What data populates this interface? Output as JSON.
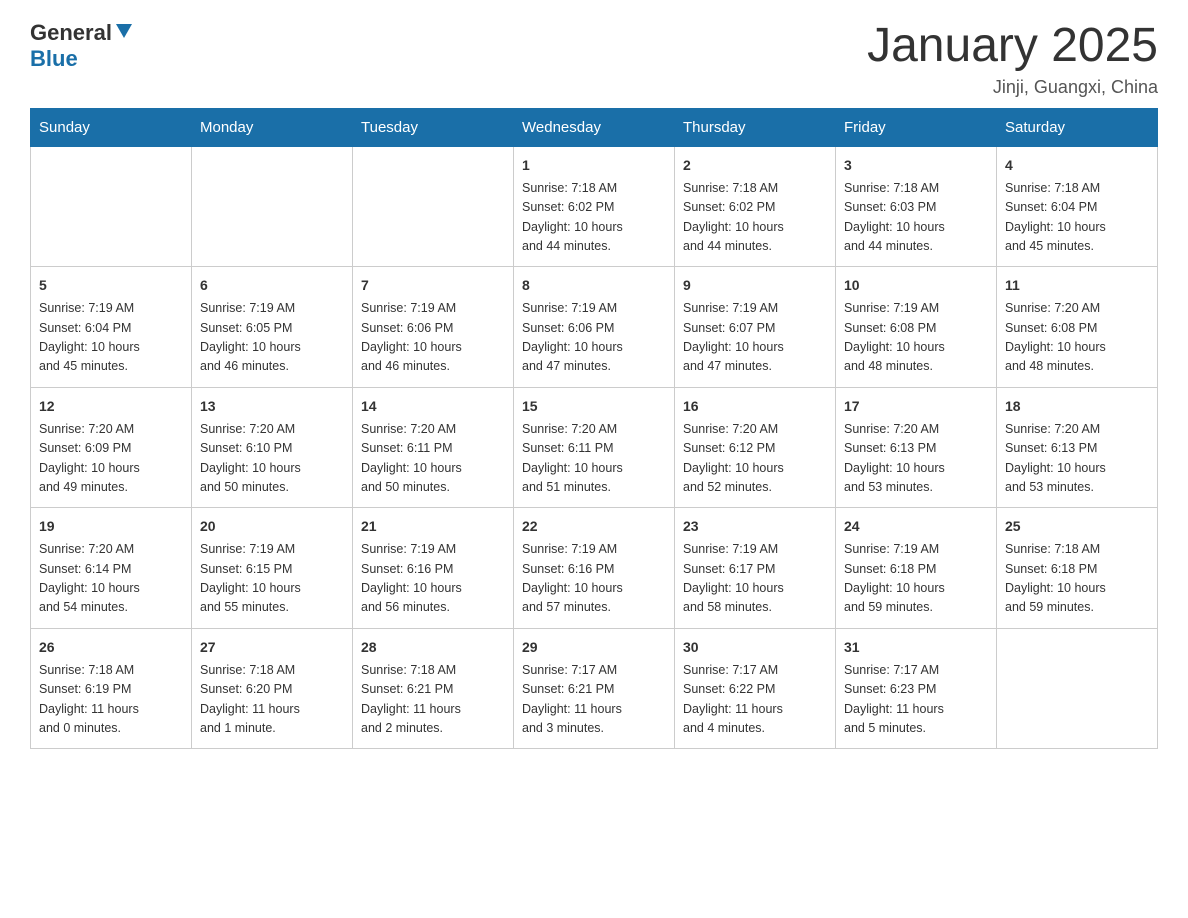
{
  "logo": {
    "general": "General",
    "blue": "Blue"
  },
  "title": "January 2025",
  "subtitle": "Jinji, Guangxi, China",
  "weekdays": [
    "Sunday",
    "Monday",
    "Tuesday",
    "Wednesday",
    "Thursday",
    "Friday",
    "Saturday"
  ],
  "weeks": [
    [
      {
        "day": "",
        "info": ""
      },
      {
        "day": "",
        "info": ""
      },
      {
        "day": "",
        "info": ""
      },
      {
        "day": "1",
        "info": "Sunrise: 7:18 AM\nSunset: 6:02 PM\nDaylight: 10 hours\nand 44 minutes."
      },
      {
        "day": "2",
        "info": "Sunrise: 7:18 AM\nSunset: 6:02 PM\nDaylight: 10 hours\nand 44 minutes."
      },
      {
        "day": "3",
        "info": "Sunrise: 7:18 AM\nSunset: 6:03 PM\nDaylight: 10 hours\nand 44 minutes."
      },
      {
        "day": "4",
        "info": "Sunrise: 7:18 AM\nSunset: 6:04 PM\nDaylight: 10 hours\nand 45 minutes."
      }
    ],
    [
      {
        "day": "5",
        "info": "Sunrise: 7:19 AM\nSunset: 6:04 PM\nDaylight: 10 hours\nand 45 minutes."
      },
      {
        "day": "6",
        "info": "Sunrise: 7:19 AM\nSunset: 6:05 PM\nDaylight: 10 hours\nand 46 minutes."
      },
      {
        "day": "7",
        "info": "Sunrise: 7:19 AM\nSunset: 6:06 PM\nDaylight: 10 hours\nand 46 minutes."
      },
      {
        "day": "8",
        "info": "Sunrise: 7:19 AM\nSunset: 6:06 PM\nDaylight: 10 hours\nand 47 minutes."
      },
      {
        "day": "9",
        "info": "Sunrise: 7:19 AM\nSunset: 6:07 PM\nDaylight: 10 hours\nand 47 minutes."
      },
      {
        "day": "10",
        "info": "Sunrise: 7:19 AM\nSunset: 6:08 PM\nDaylight: 10 hours\nand 48 minutes."
      },
      {
        "day": "11",
        "info": "Sunrise: 7:20 AM\nSunset: 6:08 PM\nDaylight: 10 hours\nand 48 minutes."
      }
    ],
    [
      {
        "day": "12",
        "info": "Sunrise: 7:20 AM\nSunset: 6:09 PM\nDaylight: 10 hours\nand 49 minutes."
      },
      {
        "day": "13",
        "info": "Sunrise: 7:20 AM\nSunset: 6:10 PM\nDaylight: 10 hours\nand 50 minutes."
      },
      {
        "day": "14",
        "info": "Sunrise: 7:20 AM\nSunset: 6:11 PM\nDaylight: 10 hours\nand 50 minutes."
      },
      {
        "day": "15",
        "info": "Sunrise: 7:20 AM\nSunset: 6:11 PM\nDaylight: 10 hours\nand 51 minutes."
      },
      {
        "day": "16",
        "info": "Sunrise: 7:20 AM\nSunset: 6:12 PM\nDaylight: 10 hours\nand 52 minutes."
      },
      {
        "day": "17",
        "info": "Sunrise: 7:20 AM\nSunset: 6:13 PM\nDaylight: 10 hours\nand 53 minutes."
      },
      {
        "day": "18",
        "info": "Sunrise: 7:20 AM\nSunset: 6:13 PM\nDaylight: 10 hours\nand 53 minutes."
      }
    ],
    [
      {
        "day": "19",
        "info": "Sunrise: 7:20 AM\nSunset: 6:14 PM\nDaylight: 10 hours\nand 54 minutes."
      },
      {
        "day": "20",
        "info": "Sunrise: 7:19 AM\nSunset: 6:15 PM\nDaylight: 10 hours\nand 55 minutes."
      },
      {
        "day": "21",
        "info": "Sunrise: 7:19 AM\nSunset: 6:16 PM\nDaylight: 10 hours\nand 56 minutes."
      },
      {
        "day": "22",
        "info": "Sunrise: 7:19 AM\nSunset: 6:16 PM\nDaylight: 10 hours\nand 57 minutes."
      },
      {
        "day": "23",
        "info": "Sunrise: 7:19 AM\nSunset: 6:17 PM\nDaylight: 10 hours\nand 58 minutes."
      },
      {
        "day": "24",
        "info": "Sunrise: 7:19 AM\nSunset: 6:18 PM\nDaylight: 10 hours\nand 59 minutes."
      },
      {
        "day": "25",
        "info": "Sunrise: 7:18 AM\nSunset: 6:18 PM\nDaylight: 10 hours\nand 59 minutes."
      }
    ],
    [
      {
        "day": "26",
        "info": "Sunrise: 7:18 AM\nSunset: 6:19 PM\nDaylight: 11 hours\nand 0 minutes."
      },
      {
        "day": "27",
        "info": "Sunrise: 7:18 AM\nSunset: 6:20 PM\nDaylight: 11 hours\nand 1 minute."
      },
      {
        "day": "28",
        "info": "Sunrise: 7:18 AM\nSunset: 6:21 PM\nDaylight: 11 hours\nand 2 minutes."
      },
      {
        "day": "29",
        "info": "Sunrise: 7:17 AM\nSunset: 6:21 PM\nDaylight: 11 hours\nand 3 minutes."
      },
      {
        "day": "30",
        "info": "Sunrise: 7:17 AM\nSunset: 6:22 PM\nDaylight: 11 hours\nand 4 minutes."
      },
      {
        "day": "31",
        "info": "Sunrise: 7:17 AM\nSunset: 6:23 PM\nDaylight: 11 hours\nand 5 minutes."
      },
      {
        "day": "",
        "info": ""
      }
    ]
  ]
}
